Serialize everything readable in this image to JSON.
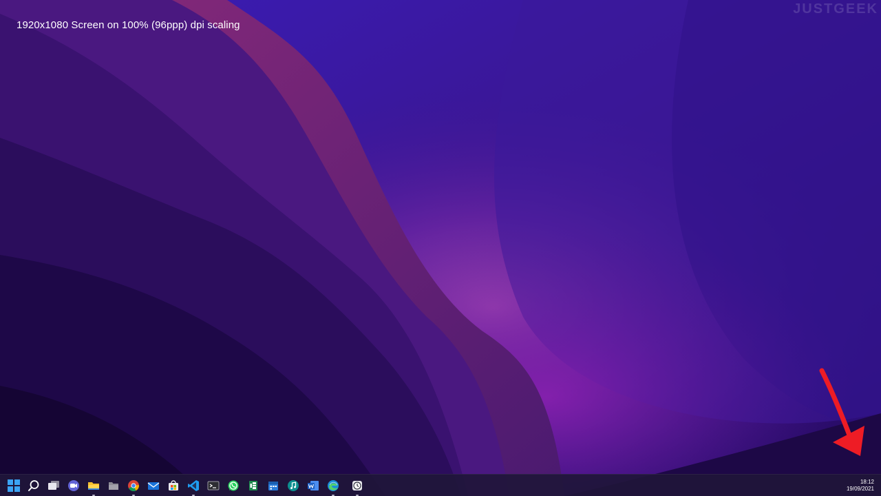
{
  "desktop": {
    "caption": "1920x1080 Screen on 100% (96ppp) dpi scaling",
    "watermark": "JUSTGEEK",
    "annotation": "red-arrow-pointing-to-clock"
  },
  "taskbar": {
    "apps": [
      {
        "name": "start-button",
        "icon": "windows-logo-icon",
        "running": false
      },
      {
        "name": "search-button",
        "icon": "search-icon",
        "running": false
      },
      {
        "name": "task-view-button",
        "icon": "task-view-icon",
        "running": false
      },
      {
        "name": "teams-chat-button",
        "icon": "teams-chat-icon",
        "running": false
      },
      {
        "name": "file-explorer-button",
        "icon": "folder-icon",
        "running": true
      },
      {
        "name": "files-app-button",
        "icon": "gray-folder-icon",
        "running": false
      },
      {
        "name": "chrome-button",
        "icon": "chrome-icon",
        "running": true
      },
      {
        "name": "mail-button",
        "icon": "mail-icon",
        "running": false
      },
      {
        "name": "microsoft-store-button",
        "icon": "store-icon",
        "running": false
      },
      {
        "name": "vscode-button",
        "icon": "vscode-icon",
        "running": true
      },
      {
        "name": "terminal-button",
        "icon": "terminal-icon",
        "running": false
      },
      {
        "name": "whatsapp-button",
        "icon": "whatsapp-icon",
        "running": false
      },
      {
        "name": "excel-like-button",
        "icon": "spreadsheet-icon",
        "running": false
      },
      {
        "name": "calendar-app-button",
        "icon": "calendar-icon",
        "running": false
      },
      {
        "name": "music-button",
        "icon": "music-note-icon",
        "running": false
      },
      {
        "name": "word-button",
        "icon": "word-icon",
        "running": false
      },
      {
        "name": "edge-button",
        "icon": "edge-icon",
        "running": true
      },
      {
        "name": "clock-app-button",
        "icon": "clock-icon",
        "running": true
      }
    ],
    "clock": {
      "time": "18:12",
      "date": "19/09/2021"
    }
  },
  "colors": {
    "accent_windows": "#3ba3f5",
    "annotation_red": "#ee1c25",
    "wallpaper_dark": "#1a0a4a",
    "wallpaper_glow": "#9a2fb0"
  }
}
